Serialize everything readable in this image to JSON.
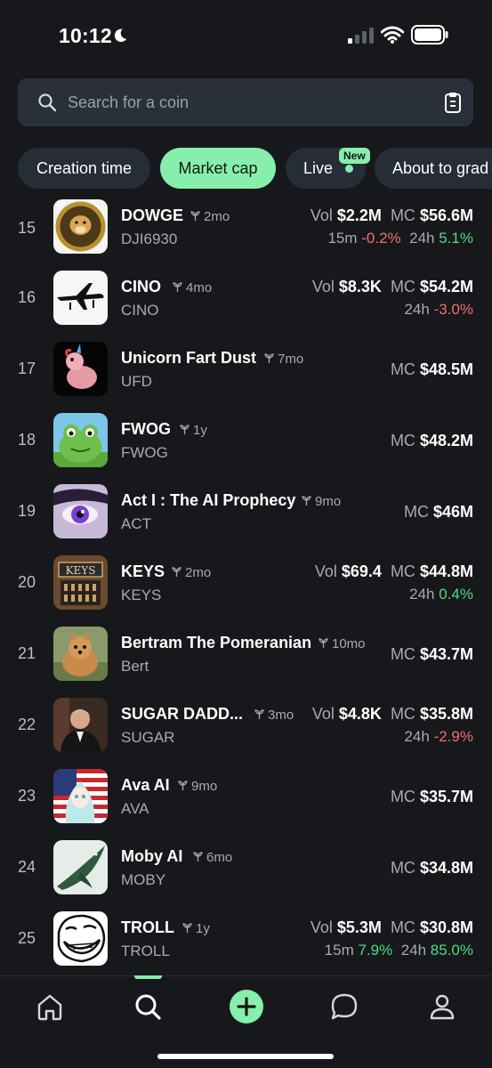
{
  "status_bar": {
    "time": "10:12"
  },
  "search": {
    "placeholder": "Search for a coin"
  },
  "chips": [
    {
      "label": "Creation time",
      "active": false
    },
    {
      "label": "Market cap",
      "active": true
    },
    {
      "label": "Live",
      "active": false,
      "badge": "New"
    },
    {
      "label": "About to grad",
      "active": false
    }
  ],
  "coins": [
    {
      "rank": "15",
      "name": "DOWGE",
      "age": "2mo",
      "ticker": "DJI6930",
      "vol_label": "Vol",
      "vol": "$2.2M",
      "mc_label": "MC",
      "mc": "$56.6M",
      "ch15_label": "15m",
      "ch15": "-0.2%",
      "ch24_label": "24h",
      "ch24": "5.1%",
      "avatar_icon": "doge-coin-icon"
    },
    {
      "rank": "16",
      "name": "CINO",
      "age": "4mo",
      "ticker": "CINO",
      "vol_label": "Vol",
      "vol": "$8.3K",
      "mc_label": "MC",
      "mc": "$54.2M",
      "ch24_label": "24h",
      "ch24": "-3.0%",
      "avatar_icon": "airplane-icon"
    },
    {
      "rank": "17",
      "name": "Unicorn Fart Dust",
      "age": "7mo",
      "ticker": "UFD",
      "mc_label": "MC",
      "mc": "$48.5M",
      "avatar_icon": "unicorn-toy-icon"
    },
    {
      "rank": "18",
      "name": "FWOG",
      "age": "1y",
      "ticker": "FWOG",
      "mc_label": "MC",
      "mc": "$48.2M",
      "avatar_icon": "frog-icon"
    },
    {
      "rank": "19",
      "name": "Act I : The AI Prophecy",
      "age": "9mo",
      "ticker": "ACT",
      "mc_label": "MC",
      "mc": "$46M",
      "avatar_icon": "anime-eye-icon"
    },
    {
      "rank": "20",
      "name": "KEYS",
      "age": "2mo",
      "ticker": "KEYS",
      "vol_label": "Vol",
      "vol": "$69.4",
      "mc_label": "MC",
      "mc": "$44.8M",
      "ch24_label": "24h",
      "ch24": "0.4%",
      "avatar_icon": "keys-sign-icon",
      "avatar_text": "KEYS"
    },
    {
      "rank": "21",
      "name": "Bertram The Pomeranian",
      "age": "10mo",
      "ticker": "Bert",
      "mc_label": "MC",
      "mc": "$43.7M",
      "avatar_icon": "pomeranian-icon"
    },
    {
      "rank": "22",
      "name": "SUGAR DADD...",
      "age": "3mo",
      "ticker": "SUGAR",
      "vol_label": "Vol",
      "vol": "$4.8K",
      "mc_label": "MC",
      "mc": "$35.8M",
      "ch24_label": "24h",
      "ch24": "-2.9%",
      "avatar_icon": "man-in-suit-icon"
    },
    {
      "rank": "23",
      "name": "Ava AI",
      "age": "9mo",
      "ticker": "AVA",
      "mc_label": "MC",
      "mc": "$35.7M",
      "avatar_icon": "anime-girl-flag-icon"
    },
    {
      "rank": "24",
      "name": "Moby AI",
      "age": "6mo",
      "ticker": "MOBY",
      "mc_label": "MC",
      "mc": "$34.8M",
      "avatar_icon": "whale-icon"
    },
    {
      "rank": "25",
      "name": "TROLL",
      "age": "1y",
      "ticker": "TROLL",
      "vol_label": "Vol",
      "vol": "$5.3M",
      "mc_label": "MC",
      "mc": "$30.8M",
      "ch15_label": "15m",
      "ch15": "7.9%",
      "ch24_label": "24h",
      "ch24": "85.0%",
      "avatar_icon": "trollface-icon"
    }
  ],
  "nav": [
    {
      "icon": "home-icon"
    },
    {
      "icon": "search-icon",
      "active": true
    },
    {
      "icon": "plus-circle-icon"
    },
    {
      "icon": "chat-bubble-icon"
    },
    {
      "icon": "profile-icon"
    }
  ],
  "colors": {
    "accent": "#86efac",
    "negative": "#f07171",
    "positive": "#4ade80",
    "background": "#17181c"
  }
}
